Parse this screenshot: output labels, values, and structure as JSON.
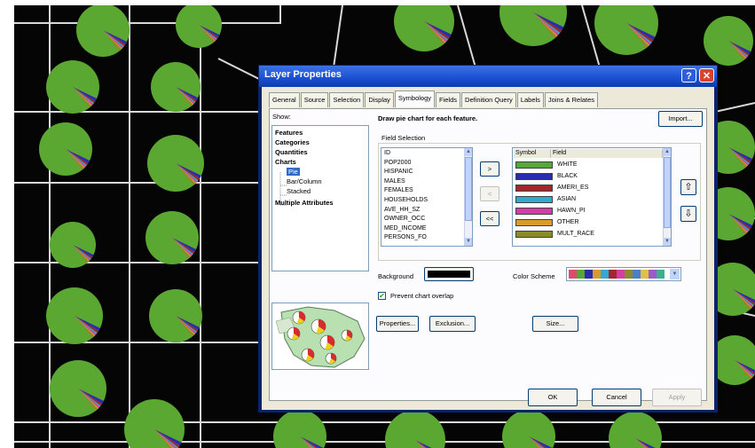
{
  "dialog": {
    "title": "Layer Properties",
    "help_glyph": "?",
    "close_glyph": "✕",
    "tabs": [
      "General",
      "Source",
      "Selection",
      "Display",
      "Symbology",
      "Fields",
      "Definition Query",
      "Labels",
      "Joins & Relates"
    ],
    "active_tab": "Symbology"
  },
  "show": {
    "label": "Show:",
    "items": [
      {
        "text": "Features",
        "bold": true
      },
      {
        "text": "Categories",
        "bold": true
      },
      {
        "text": "Quantities",
        "bold": true
      },
      {
        "text": "Charts",
        "bold": true
      },
      {
        "text": "Pie",
        "selected": true
      },
      {
        "text": "Bar/Column"
      },
      {
        "text": "Stacked"
      },
      {
        "text": "Multiple Attributes",
        "bold": true
      }
    ]
  },
  "heading": "Draw pie chart for each feature.",
  "import_label": "Import...",
  "field_selection": {
    "label": "Field Selection",
    "fields": [
      "ID",
      "POP2000",
      "HISPANIC",
      "MALES",
      "FEMALES",
      "HOUSEHOLDS",
      "AVE_HH_SZ",
      "OWNER_OCC",
      "MED_INCOME",
      "PERSONS_FO"
    ],
    "move_right": ">",
    "move_left": "<",
    "move_all_left": "<<",
    "symbol_header": "Symbol",
    "field_header": "Field",
    "symbols": [
      {
        "field": "WHITE",
        "color": "#57a638"
      },
      {
        "field": "BLACK",
        "color": "#2b2bb0"
      },
      {
        "field": "AMERI_ES",
        "color": "#a3262b"
      },
      {
        "field": "ASIAN",
        "color": "#34a9d0"
      },
      {
        "field": "HAWN_PI",
        "color": "#d63da4"
      },
      {
        "field": "OTHER",
        "color": "#d99b2b"
      },
      {
        "field": "MULT_RACE",
        "color": "#8b8b2b"
      }
    ],
    "move_up": "⇧",
    "move_down": "⇩"
  },
  "background_label": "Background",
  "color_scheme_label": "Color Scheme",
  "prevent_overlap_label": "Prevent chart overlap",
  "prevent_overlap_checked": true,
  "buttons": {
    "properties": "Properties...",
    "exclusion": "Exclusion...",
    "size": "Size...",
    "ok": "OK",
    "cancel": "Cancel",
    "apply": "Apply"
  },
  "colors": {
    "pie_main": "#5aa832",
    "map_bg": "#050505",
    "roads": "#d8d8d8",
    "dialog_face": "#ece9d8",
    "titlebar": "#1a4fd1",
    "selection": "#316ac5"
  },
  "color_scheme_colors": [
    "#d94f6a",
    "#57a638",
    "#2b2bb0",
    "#d99b2b",
    "#34a9d0",
    "#a3262b",
    "#d63da4",
    "#8b8b2b",
    "#4a7fd0",
    "#e0c040",
    "#9b5bc8",
    "#3ab08e"
  ]
}
